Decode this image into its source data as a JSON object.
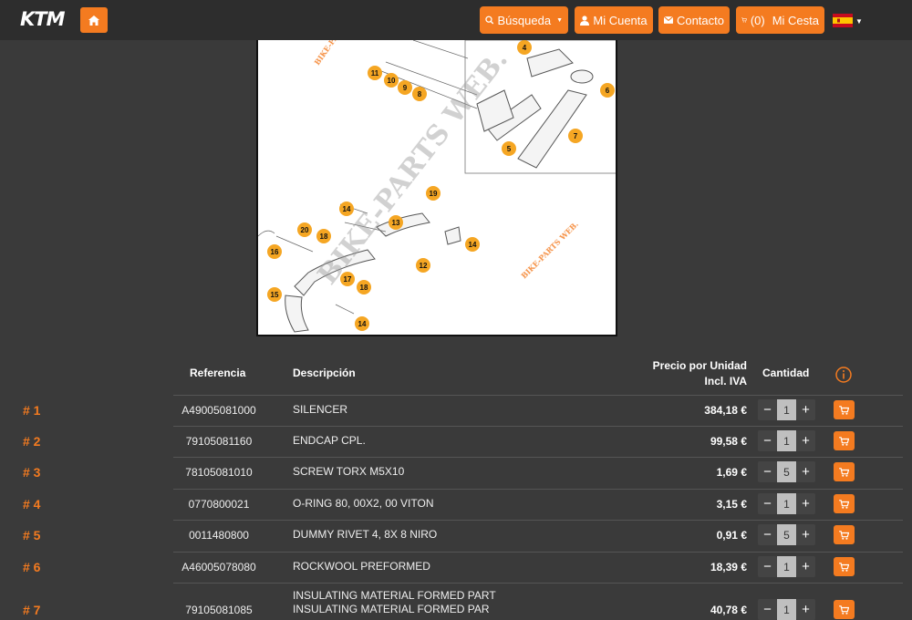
{
  "header": {
    "logo_text": "KTM",
    "search_label": "Búsqueda",
    "account_label": "Mi Cuenta",
    "contact_label": "Contacto",
    "cart_count": "(0)",
    "cart_label": "Mi Cesta",
    "language_flag": "es-flag-icon"
  },
  "diagram": {
    "watermark": "BIKE-PARTS WEB.",
    "callouts": [
      "4",
      "6",
      "7",
      "5",
      "11",
      "10",
      "9",
      "8",
      "19",
      "14",
      "13",
      "20",
      "18",
      "16",
      "12",
      "14",
      "17",
      "18",
      "15",
      "14"
    ]
  },
  "table": {
    "headers": {
      "ref": "Referencia",
      "desc": "Descripción",
      "price_line1": "Precio por Unidad",
      "price_line2": "Incl. IVA",
      "qty": "Cantidad",
      "info_icon": "info-icon"
    },
    "rows": [
      {
        "num": "# 1",
        "ref": "A49005081000",
        "desc": "SILENCER",
        "desc2": "",
        "price": "384,18 €",
        "qty": "1"
      },
      {
        "num": "# 2",
        "ref": "79105081160",
        "desc": "ENDCAP CPL.",
        "desc2": "",
        "price": "99,58 €",
        "qty": "1"
      },
      {
        "num": "# 3",
        "ref": "78105081010",
        "desc": "SCREW TORX M5X10",
        "desc2": "",
        "price": "1,69 €",
        "qty": "5"
      },
      {
        "num": "# 4",
        "ref": "0770800021",
        "desc": "O-RING 80, 00X2, 00 VITON",
        "desc2": "",
        "price": "3,15 €",
        "qty": "1"
      },
      {
        "num": "# 5",
        "ref": "0011480800",
        "desc": "DUMMY RIVET 4, 8X 8 NIRO",
        "desc2": "",
        "price": "0,91 €",
        "qty": "5"
      },
      {
        "num": "# 6",
        "ref": "A46005078080",
        "desc": "ROCKWOOL PREFORMED",
        "desc2": "",
        "price": "18,39 €",
        "qty": "1"
      },
      {
        "num": "# 7",
        "ref": "79105081085",
        "desc": "INSULATING MATERIAL FORMED PART",
        "desc2": "INSULATING MATERIAL FORMED PAR",
        "price": "40,78 €",
        "qty": "1"
      }
    ],
    "minus": "−",
    "plus": "+"
  }
}
